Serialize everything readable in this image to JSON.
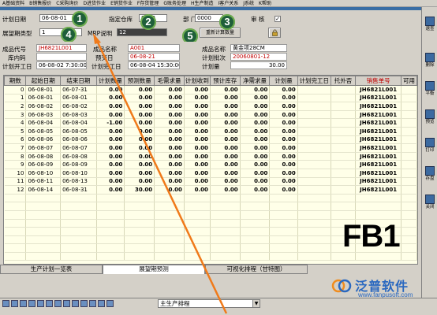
{
  "menu": [
    "A基础资料",
    "B销售报价",
    "C采购询价",
    "D进货作业",
    "E销货作业",
    "F存货管理",
    "G账务处理",
    "H生产制造",
    "I客户关系",
    "J系统",
    "K帮助"
  ],
  "form": {
    "plan_date_label": "计划日期",
    "plan_date_value": "06-08-01",
    "warehouse_label": "指定仓库",
    "warehouse_value": "0000",
    "dept_label": "部  门",
    "dept_value": "0000",
    "review_label": "审  核",
    "review_checked": "✓",
    "period_type_label": "展望期类型",
    "period_type_value": "1",
    "mrp_label": "MRP说明",
    "mrp_value": "12",
    "calc_button": "重新计算数量",
    "lock_icon": "lock-icon"
  },
  "markers": [
    "1",
    "2",
    "3",
    "4",
    "5"
  ],
  "info": {
    "product_code_label": "成品代号",
    "product_code_value": "JH6821L001",
    "product_name_label": "成品名称",
    "product_name_value": "A001",
    "product_name2_label": "成品名称",
    "product_name2_value": "黄金项28CM",
    "inner_code_label": "库内码",
    "inner_code_value": "",
    "delivery_label": "预交日",
    "delivery_value": "06-08-21",
    "batch_label": "计划批次",
    "batch_value": "20060801-12",
    "start_label": "计划开工日",
    "start_value": "06-08-02 7:30:00",
    "finish_label": "计划完工日",
    "finish_value": "06-08-04 15:30:00",
    "plan_qty_label": "计划量",
    "plan_qty_value": "30.00"
  },
  "table": {
    "columns": [
      "期数",
      "起始日期",
      "结束日期",
      "计划数量",
      "预测数量",
      "毛需求量",
      "计划收到",
      "预计库存",
      "净需求量",
      "计划量",
      "计划完工日",
      "托外否",
      "销售单号",
      "可用"
    ],
    "rows": [
      [
        "0",
        "06-08-01",
        "06-07-31",
        "0.00",
        "0.00",
        "0.00",
        "0.00",
        "0.00",
        "0.00",
        "0.00",
        "",
        "",
        "JH6821L001",
        ""
      ],
      [
        "1",
        "06-08-01",
        "06-08-01",
        "0.00",
        "0.00",
        "0.00",
        "0.00",
        "0.00",
        "0.00",
        "0.00",
        "",
        "",
        "JH6821L001",
        ""
      ],
      [
        "2",
        "06-08-02",
        "06-08-02",
        "0.00",
        "0.00",
        "0.00",
        "0.00",
        "0.00",
        "0.00",
        "0.00",
        "",
        "",
        "JH6821L001",
        ""
      ],
      [
        "3",
        "06-08-03",
        "06-08-03",
        "0.00",
        "0.00",
        "0.00",
        "0.00",
        "0.00",
        "0.00",
        "0.00",
        "",
        "",
        "JH6821L001",
        ""
      ],
      [
        "4",
        "06-08-04",
        "06-08-04",
        "-1.00",
        "0.00",
        "0.00",
        "0.00",
        "0.00",
        "0.00",
        "0.00",
        "",
        "",
        "JH6821L001",
        ""
      ],
      [
        "5",
        "06-08-05",
        "06-08-05",
        "0.00",
        "0.00",
        "0.00",
        "0.00",
        "0.00",
        "0.00",
        "0.00",
        "",
        "",
        "JH6821L001",
        ""
      ],
      [
        "6",
        "06-08-06",
        "06-08-06",
        "0.00",
        "0.00",
        "0.00",
        "0.00",
        "0.00",
        "0.00",
        "0.00",
        "",
        "",
        "JH6821L001",
        ""
      ],
      [
        "7",
        "06-08-07",
        "06-08-07",
        "0.00",
        "0.00",
        "0.00",
        "0.00",
        "0.00",
        "0.00",
        "0.00",
        "",
        "",
        "JH6821L001",
        ""
      ],
      [
        "8",
        "06-08-08",
        "06-08-08",
        "0.00",
        "0.00",
        "0.00",
        "0.00",
        "0.00",
        "0.00",
        "0.00",
        "",
        "",
        "JH6821L001",
        ""
      ],
      [
        "9",
        "06-08-09",
        "06-08-09",
        "0.00",
        "0.00",
        "0.00",
        "0.00",
        "0.00",
        "0.00",
        "0.00",
        "",
        "",
        "JH6821L001",
        ""
      ],
      [
        "10",
        "06-08-10",
        "06-08-10",
        "0.00",
        "0.00",
        "0.00",
        "0.00",
        "0.00",
        "0.00",
        "0.00",
        "",
        "",
        "JH6821L001",
        ""
      ],
      [
        "11",
        "06-08-11",
        "06-08-13",
        "0.00",
        "0.00",
        "0.00",
        "0.00",
        "0.00",
        "0.00",
        "0.00",
        "",
        "",
        "JH6821L001",
        ""
      ],
      [
        "12",
        "06-08-14",
        "06-08-31",
        "0.00",
        "30.00",
        "0.00",
        "0.00",
        "0.00",
        "0.00",
        "0.00",
        "",
        "",
        "JH6821L001",
        ""
      ]
    ]
  },
  "fb_label": "FB1",
  "tabs": [
    "生产计划一览表",
    "展望期预测",
    "可视化排程（甘特图）"
  ],
  "status": {
    "combo_value": "主生产排程"
  },
  "sidebar": [
    "速查",
    "删除",
    "平衡",
    "预览",
    "打印",
    "存盘",
    "关闭"
  ],
  "watermark": {
    "title": "泛普软件",
    "url": "www.fanpusoft.com"
  },
  "colors": {
    "accent_red": "#c00000",
    "marker_green": "#1f5f3a",
    "arrow_orange": "#f07a1a",
    "brand_blue": "#2a68c0"
  }
}
